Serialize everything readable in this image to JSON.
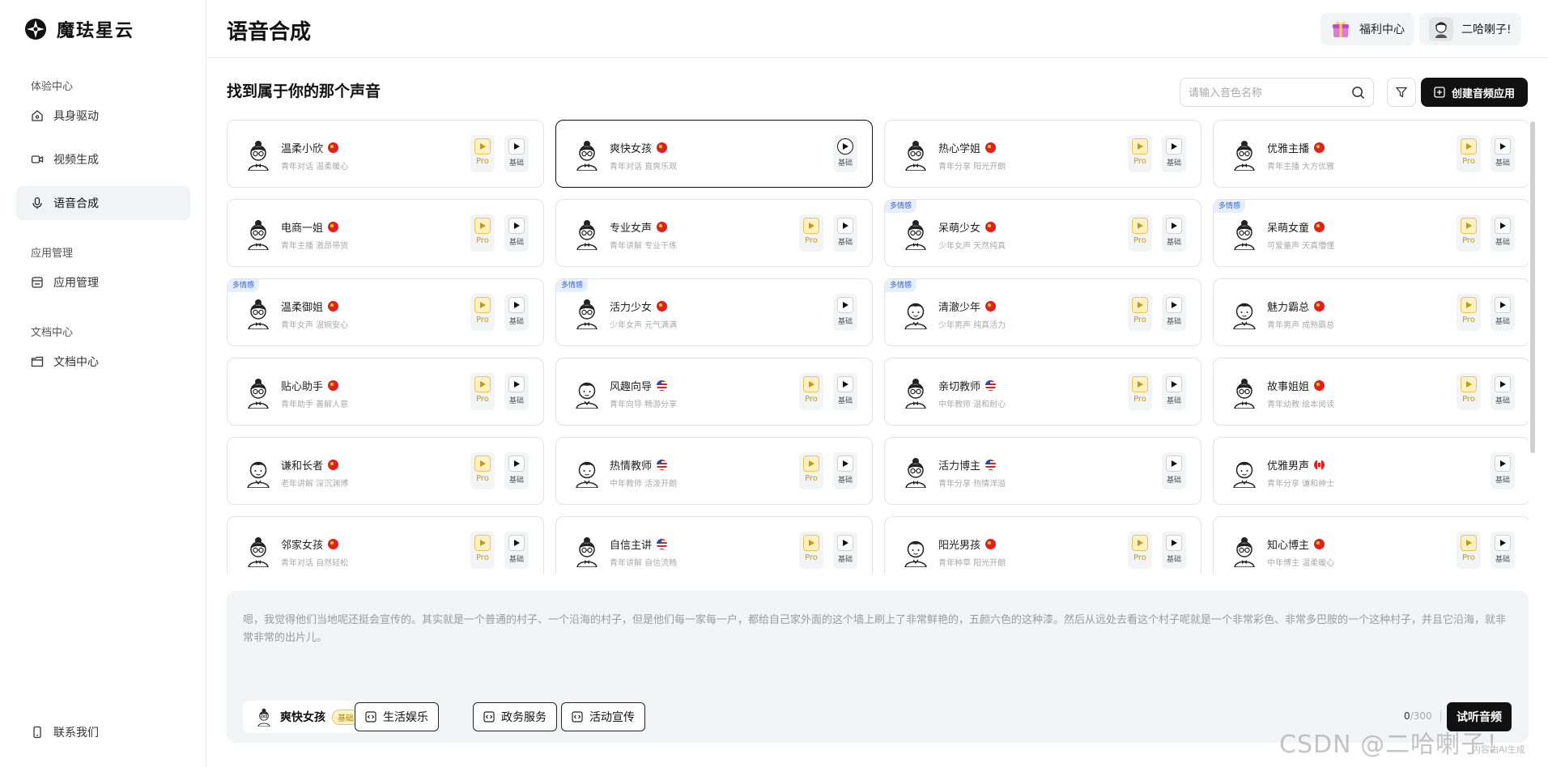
{
  "brand": {
    "name": "魔珐星云"
  },
  "sidebar": {
    "sections": [
      {
        "title": "体验中心",
        "items": [
          {
            "label": "具身驱动",
            "icon": "home-icon",
            "active": false
          },
          {
            "label": "视频生成",
            "icon": "video-icon",
            "active": false
          },
          {
            "label": "语音合成",
            "icon": "mic-icon",
            "active": true
          }
        ]
      },
      {
        "title": "应用管理",
        "items": [
          {
            "label": "应用管理",
            "icon": "app-icon",
            "active": false
          }
        ]
      },
      {
        "title": "文档中心",
        "items": [
          {
            "label": "文档中心",
            "icon": "folder-icon",
            "active": false
          }
        ]
      }
    ],
    "contact_label": "联系我们"
  },
  "header": {
    "title": "语音合成",
    "welfare_label": "福利中心",
    "user_name": "二哈喇子!"
  },
  "toolbar": {
    "section_title": "找到属于你的那个声音",
    "search_placeholder": "请输入音色名称",
    "create_label": "创建音频应用"
  },
  "voice_labels": {
    "pro": "Pro",
    "basic": "基础"
  },
  "voices": [
    {
      "name": "温柔小欣",
      "desc": "青年对话 温柔暖心",
      "flag": "cn",
      "pro": true,
      "tag": "",
      "gender": "f"
    },
    {
      "name": "爽快女孩",
      "desc": "青年对话 直爽乐观",
      "flag": "cn",
      "pro": false,
      "tag": "",
      "gender": "f",
      "selected": true
    },
    {
      "name": "热心学姐",
      "desc": "青年分享 阳光开朗",
      "flag": "cn",
      "pro": true,
      "tag": "",
      "gender": "f"
    },
    {
      "name": "优雅主播",
      "desc": "青年主播 大方优雅",
      "flag": "cn",
      "pro": true,
      "tag": "",
      "gender": "f"
    },
    {
      "name": "电商一姐",
      "desc": "青年主播 激昂带货",
      "flag": "cn",
      "pro": true,
      "tag": "",
      "gender": "f"
    },
    {
      "name": "专业女声",
      "desc": "青年讲解 专业干练",
      "flag": "cn",
      "pro": true,
      "tag": "",
      "gender": "f"
    },
    {
      "name": "呆萌少女",
      "desc": "少年女声 天然纯真",
      "flag": "cn",
      "pro": true,
      "tag": "多情感",
      "gender": "f"
    },
    {
      "name": "呆萌女童",
      "desc": "可爱童声 天真懵懂",
      "flag": "cn",
      "pro": true,
      "tag": "多情感",
      "gender": "f"
    },
    {
      "name": "温柔御姐",
      "desc": "青年女声 温婉安心",
      "flag": "cn",
      "pro": true,
      "tag": "多情感",
      "gender": "f"
    },
    {
      "name": "活力少女",
      "desc": "少年女声 元气满满",
      "flag": "cn",
      "pro": false,
      "tag": "多情感",
      "gender": "f"
    },
    {
      "name": "清澈少年",
      "desc": "少年男声 纯真活力",
      "flag": "cn",
      "pro": true,
      "tag": "多情感",
      "gender": "m"
    },
    {
      "name": "魅力霸总",
      "desc": "青年男声 成熟霸总",
      "flag": "cn",
      "pro": true,
      "tag": "",
      "gender": "m"
    },
    {
      "name": "贴心助手",
      "desc": "青年助手 善解人意",
      "flag": "cn",
      "pro": true,
      "tag": "",
      "gender": "f"
    },
    {
      "name": "风趣向导",
      "desc": "青年向导 畅游分享",
      "flag": "us",
      "pro": true,
      "tag": "",
      "gender": "m"
    },
    {
      "name": "亲切教师",
      "desc": "中年教师 温和耐心",
      "flag": "us",
      "pro": true,
      "tag": "",
      "gender": "f"
    },
    {
      "name": "故事姐姐",
      "desc": "青年幼教 绘本阅读",
      "flag": "cn",
      "pro": true,
      "tag": "",
      "gender": "f"
    },
    {
      "name": "谦和长者",
      "desc": "老年讲解 深沉渊博",
      "flag": "cn",
      "pro": true,
      "tag": "",
      "gender": "m"
    },
    {
      "name": "热情教师",
      "desc": "中年教师 活泼开朗",
      "flag": "us",
      "pro": true,
      "tag": "",
      "gender": "m"
    },
    {
      "name": "活力博主",
      "desc": "青年分享 热情洋溢",
      "flag": "us",
      "pro": false,
      "tag": "",
      "gender": "f"
    },
    {
      "name": "优雅男声",
      "desc": "青年分享 谦和绅士",
      "flag": "ca",
      "pro": false,
      "tag": "",
      "gender": "m"
    },
    {
      "name": "邻家女孩",
      "desc": "青年对话 自然轻松",
      "flag": "cn",
      "pro": true,
      "tag": "",
      "gender": "f"
    },
    {
      "name": "自信主讲",
      "desc": "青年讲解 自信流畅",
      "flag": "us",
      "pro": true,
      "tag": "",
      "gender": "f"
    },
    {
      "name": "阳光男孩",
      "desc": "青年种草 阳光开朗",
      "flag": "cn",
      "pro": true,
      "tag": "",
      "gender": "m"
    },
    {
      "name": "知心博主",
      "desc": "中年博主 温柔暖心",
      "flag": "cn",
      "pro": true,
      "tag": "",
      "gender": "f"
    }
  ],
  "composer": {
    "text": "嗯，我觉得他们当地呢还挺会宣传的。其实就是一个普通的村子、一个沿海的村子，但是他们每一家每一户，都给自己家外面的这个墙上刷上了非常鲜艳的，五颜六色的这种漆。然后从远处去看这个村子呢就是一个非常彩色、非常多巴胺的一个这种村子，并且它沿海，就非常非常的出片儿。",
    "selected_voice": "爽快女孩",
    "selected_badge": "基础",
    "scenes": [
      "生活娱乐",
      "政务服务",
      "活动宣传"
    ],
    "count": "0",
    "max": "/300",
    "try_label": "试听音频"
  },
  "watermark": "CSDN @二哈喇子！",
  "ai_note": "内容由AI生成"
}
